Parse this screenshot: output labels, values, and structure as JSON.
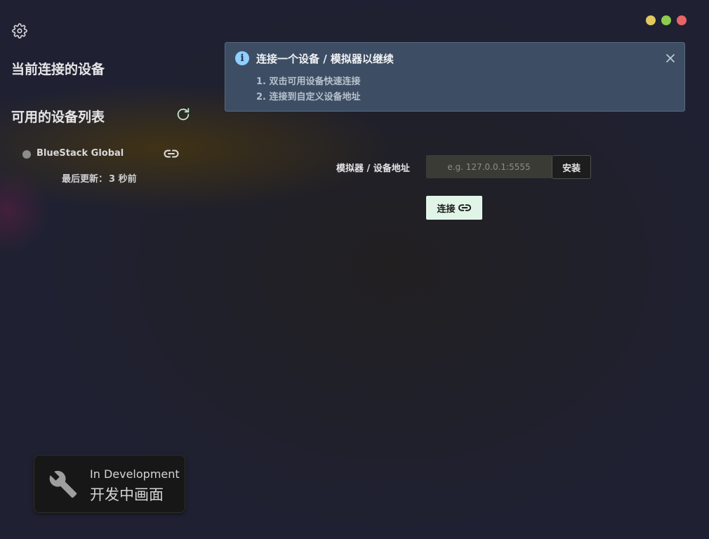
{
  "window_controls": {
    "colors": {
      "minimize": "#e1c960",
      "maximize": "#8ccd4e",
      "close": "#e76566"
    }
  },
  "sidebar": {
    "settings_icon": "gear-icon",
    "current_device_title": "当前连接的设备",
    "available_title": "可用的设备列表",
    "refresh_icon": "refresh-icon",
    "devices": [
      {
        "name": "BlueStack Global",
        "status_color": "#8c8c8c",
        "link_icon": "link-icon",
        "last_update_label": "最后更新：",
        "last_update_value": "3 秒前"
      }
    ]
  },
  "info_banner": {
    "icon": "info-icon",
    "title": "连接一个设备 / 模拟器以继续",
    "steps": [
      "1. 双击可用设备快速连接",
      "2. 连接到自定义设备地址"
    ],
    "close_icon": "close-icon",
    "background": "#3d4e64",
    "accent": "#8fd0ff"
  },
  "connect_form": {
    "address_label": "模拟器 / 设备地址",
    "address_value": "",
    "address_placeholder": "e.g. 127.0.0.1:5555",
    "install_label": "安装",
    "connect_label": "连接",
    "connect_icon": "link-icon",
    "connect_bg": "#e1f4e8"
  },
  "dev_badge": {
    "icon": "wrench-icon",
    "label_en": "In Development",
    "label_cn": "开发中画面"
  }
}
